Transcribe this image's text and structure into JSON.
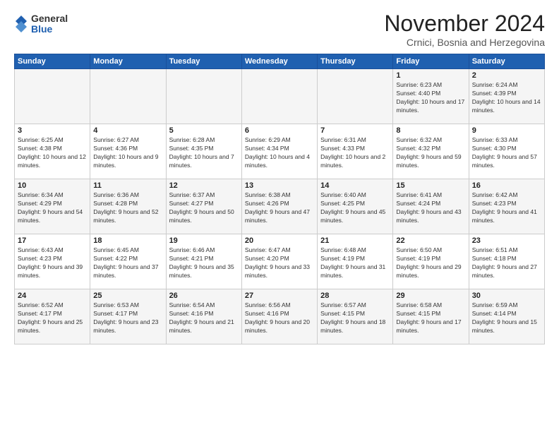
{
  "logo": {
    "general": "General",
    "blue": "Blue"
  },
  "title": "November 2024",
  "location": "Crnici, Bosnia and Herzegovina",
  "headers": [
    "Sunday",
    "Monday",
    "Tuesday",
    "Wednesday",
    "Thursday",
    "Friday",
    "Saturday"
  ],
  "rows": [
    [
      {
        "day": "",
        "info": ""
      },
      {
        "day": "",
        "info": ""
      },
      {
        "day": "",
        "info": ""
      },
      {
        "day": "",
        "info": ""
      },
      {
        "day": "",
        "info": ""
      },
      {
        "day": "1",
        "info": "Sunrise: 6:23 AM\nSunset: 4:40 PM\nDaylight: 10 hours and 17 minutes."
      },
      {
        "day": "2",
        "info": "Sunrise: 6:24 AM\nSunset: 4:39 PM\nDaylight: 10 hours and 14 minutes."
      }
    ],
    [
      {
        "day": "3",
        "info": "Sunrise: 6:25 AM\nSunset: 4:38 PM\nDaylight: 10 hours and 12 minutes."
      },
      {
        "day": "4",
        "info": "Sunrise: 6:27 AM\nSunset: 4:36 PM\nDaylight: 10 hours and 9 minutes."
      },
      {
        "day": "5",
        "info": "Sunrise: 6:28 AM\nSunset: 4:35 PM\nDaylight: 10 hours and 7 minutes."
      },
      {
        "day": "6",
        "info": "Sunrise: 6:29 AM\nSunset: 4:34 PM\nDaylight: 10 hours and 4 minutes."
      },
      {
        "day": "7",
        "info": "Sunrise: 6:31 AM\nSunset: 4:33 PM\nDaylight: 10 hours and 2 minutes."
      },
      {
        "day": "8",
        "info": "Sunrise: 6:32 AM\nSunset: 4:32 PM\nDaylight: 9 hours and 59 minutes."
      },
      {
        "day": "9",
        "info": "Sunrise: 6:33 AM\nSunset: 4:30 PM\nDaylight: 9 hours and 57 minutes."
      }
    ],
    [
      {
        "day": "10",
        "info": "Sunrise: 6:34 AM\nSunset: 4:29 PM\nDaylight: 9 hours and 54 minutes."
      },
      {
        "day": "11",
        "info": "Sunrise: 6:36 AM\nSunset: 4:28 PM\nDaylight: 9 hours and 52 minutes."
      },
      {
        "day": "12",
        "info": "Sunrise: 6:37 AM\nSunset: 4:27 PM\nDaylight: 9 hours and 50 minutes."
      },
      {
        "day": "13",
        "info": "Sunrise: 6:38 AM\nSunset: 4:26 PM\nDaylight: 9 hours and 47 minutes."
      },
      {
        "day": "14",
        "info": "Sunrise: 6:40 AM\nSunset: 4:25 PM\nDaylight: 9 hours and 45 minutes."
      },
      {
        "day": "15",
        "info": "Sunrise: 6:41 AM\nSunset: 4:24 PM\nDaylight: 9 hours and 43 minutes."
      },
      {
        "day": "16",
        "info": "Sunrise: 6:42 AM\nSunset: 4:23 PM\nDaylight: 9 hours and 41 minutes."
      }
    ],
    [
      {
        "day": "17",
        "info": "Sunrise: 6:43 AM\nSunset: 4:23 PM\nDaylight: 9 hours and 39 minutes."
      },
      {
        "day": "18",
        "info": "Sunrise: 6:45 AM\nSunset: 4:22 PM\nDaylight: 9 hours and 37 minutes."
      },
      {
        "day": "19",
        "info": "Sunrise: 6:46 AM\nSunset: 4:21 PM\nDaylight: 9 hours and 35 minutes."
      },
      {
        "day": "20",
        "info": "Sunrise: 6:47 AM\nSunset: 4:20 PM\nDaylight: 9 hours and 33 minutes."
      },
      {
        "day": "21",
        "info": "Sunrise: 6:48 AM\nSunset: 4:19 PM\nDaylight: 9 hours and 31 minutes."
      },
      {
        "day": "22",
        "info": "Sunrise: 6:50 AM\nSunset: 4:19 PM\nDaylight: 9 hours and 29 minutes."
      },
      {
        "day": "23",
        "info": "Sunrise: 6:51 AM\nSunset: 4:18 PM\nDaylight: 9 hours and 27 minutes."
      }
    ],
    [
      {
        "day": "24",
        "info": "Sunrise: 6:52 AM\nSunset: 4:17 PM\nDaylight: 9 hours and 25 minutes."
      },
      {
        "day": "25",
        "info": "Sunrise: 6:53 AM\nSunset: 4:17 PM\nDaylight: 9 hours and 23 minutes."
      },
      {
        "day": "26",
        "info": "Sunrise: 6:54 AM\nSunset: 4:16 PM\nDaylight: 9 hours and 21 minutes."
      },
      {
        "day": "27",
        "info": "Sunrise: 6:56 AM\nSunset: 4:16 PM\nDaylight: 9 hours and 20 minutes."
      },
      {
        "day": "28",
        "info": "Sunrise: 6:57 AM\nSunset: 4:15 PM\nDaylight: 9 hours and 18 minutes."
      },
      {
        "day": "29",
        "info": "Sunrise: 6:58 AM\nSunset: 4:15 PM\nDaylight: 9 hours and 17 minutes."
      },
      {
        "day": "30",
        "info": "Sunrise: 6:59 AM\nSunset: 4:14 PM\nDaylight: 9 hours and 15 minutes."
      }
    ]
  ]
}
